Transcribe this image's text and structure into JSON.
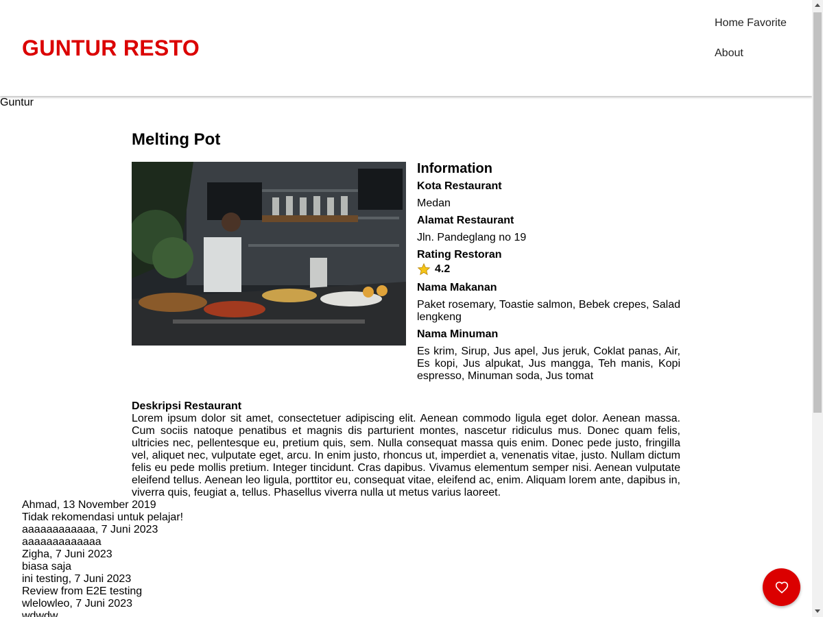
{
  "header": {
    "brand": "GUNTUR RESTO",
    "nav": [
      "Home",
      "Favorite",
      "About"
    ]
  },
  "hero": {
    "alt": "Guntur"
  },
  "restaurant": {
    "name": "Melting Pot",
    "image_alt": "Melting Pot",
    "info_title": "Information",
    "city_label": "Kota Restaurant",
    "city": "Medan",
    "address_label": "Alamat Restaurant",
    "address": "Jln. Pandeglang no 19",
    "rating_label": "Rating Restoran",
    "rating": "4.2",
    "foods_label": "Nama Makanan",
    "foods": "Paket rosemary, Toastie salmon, Bebek crepes, Salad lengkeng",
    "drinks_label": "Nama Minuman",
    "drinks": "Es krim, Sirup, Jus apel, Jus jeruk, Coklat panas, Air, Es kopi, Jus alpukat, Jus mangga, Teh manis, Kopi espresso, Minuman soda, Jus tomat",
    "description_label": "Deskripsi Restaurant",
    "description": "Lorem ipsum dolor sit amet, consectetuer adipiscing elit. Aenean commodo ligula eget dolor. Aenean massa. Cum sociis natoque penatibus et magnis dis parturient montes, nascetur ridiculus mus. Donec quam felis, ultricies nec, pellentesque eu, pretium quis, sem. Nulla consequat massa quis enim. Donec pede justo, fringilla vel, aliquet nec, vulputate eget, arcu. In enim justo, rhoncus ut, imperdiet a, venenatis vitae, justo. Nullam dictum felis eu pede mollis pretium. Integer tincidunt. Cras dapibus. Vivamus elementum semper nisi. Aenean vulputate eleifend tellus. Aenean leo ligula, porttitor eu, consequat vitae, eleifend ac, enim. Aliquam lorem ante, dapibus in, viverra quis, feugiat a, tellus. Phasellus viverra nulla ut metus varius laoreet."
  },
  "reviews": [
    {
      "header": "Ahmad, 13 November 2019",
      "text": "Tidak rekomendasi untuk pelajar!"
    },
    {
      "header": "aaaaaaaaaaaa, 7 Juni 2023",
      "text": "aaaaaaaaaaaaa"
    },
    {
      "header": "Zigha, 7 Juni 2023",
      "text": "biasa saja"
    },
    {
      "header": "ini testing, 7 Juni 2023",
      "text": "Review from E2E testing"
    },
    {
      "header": "wlelowleo, 7 Juni 2023",
      "text": "wdwdw"
    }
  ],
  "fab": {
    "icon": "heart-outline-icon",
    "color": "#db0000"
  },
  "colors": {
    "brand": "#db0000",
    "star": "#f5c518"
  }
}
